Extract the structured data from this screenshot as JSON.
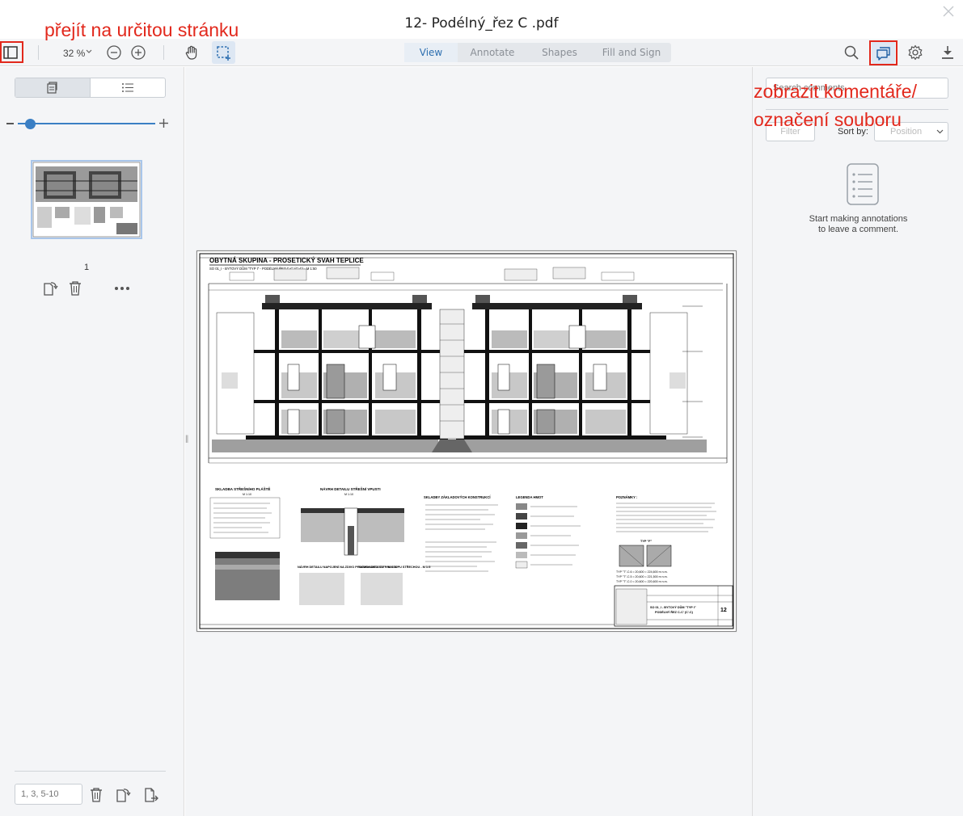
{
  "window": {
    "title": "12- Podélný_řez C .pdf"
  },
  "toolbar": {
    "zoom_value": "32 %",
    "mode_tabs": [
      {
        "label": "View",
        "active": true
      },
      {
        "label": "Annotate",
        "active": false
      },
      {
        "label": "Shapes",
        "active": false
      },
      {
        "label": "Fill and Sign",
        "active": false
      }
    ],
    "icons": [
      "sidebar-toggle-icon",
      "zoom-out-icon",
      "zoom-in-icon",
      "pan-hand-icon",
      "marquee-select-icon",
      "search-icon",
      "comments-icon",
      "settings-gear-icon",
      "download-icon"
    ]
  },
  "left_panel": {
    "page_label": "1",
    "page_range_placeholder": "1, 3, 5-10"
  },
  "right_panel": {
    "search_placeholder": "Search comments",
    "filter_label": "Filter",
    "sort_label": "Sort by:",
    "sort_value": "Position",
    "empty_message_line1": "Start making annotations",
    "empty_message_line2": "to leave a comment."
  },
  "annotations": {
    "goto_page": "přejít na určitou stránku",
    "show_comments_line1": "zobrazit komentáře/",
    "show_comments_line2": "označení souboru"
  },
  "drawing": {
    "title": "OBYTNÁ SKUPINA - PROSETICKÝ SVAH TEPLICE",
    "subtitle": "SO 01_I - BYTOVÝ DŮM \"TYP I\" - PODÉLNÝ ŘEZ C-C' (C'-C) - M 1:50",
    "section_skladba": "SKLADBA STŘEŠNÍHO PLÁŠTĚ",
    "section_skladba_scale": "M 1:10",
    "section_navrh": "NÁVRH DETAILU STŘEŠNÍ VPUSTI",
    "section_navrh_scale": "M 1:10",
    "section_zakladove": "SKLADBY ZÁKLADOVÝCH KONSTRUKCÍ",
    "section_legenda": "LEGENDA HMOT",
    "section_poznamky": "POZNÁMKY :",
    "section_napojeni": "NÁVRH DETAILU NAPOJENÍ NA ZDIVO PRO SKLADBU \"T1\" - M 1:10",
    "section_prostup": "NÁVRH DETAILU PROSTUPU STŘECHOU - M 1:5",
    "typ_label": "TYP \"F\"",
    "levels": [
      "TYP \"T\"-C.6 = 20,600 = 224,600 m n.m.",
      "TYP \"T\"-C.5 = 20,600 = 221,500 m n.m.",
      "TYP \"T\"-C.0 = 20,600 = 220,600 m n.m."
    ],
    "stamp_title": "SO 01_I - BYTOVÝ DŮM \"TYP I\"",
    "stamp_subtitle": "PODÉLNÝ ŘEZ C-C' (C'-C)",
    "stamp_number": "12"
  },
  "colors": {
    "accent": "#2d6fb0",
    "slider": "#3b7fc4",
    "annotation_red": "#e2281c",
    "panel_bg": "#f4f5f7"
  }
}
